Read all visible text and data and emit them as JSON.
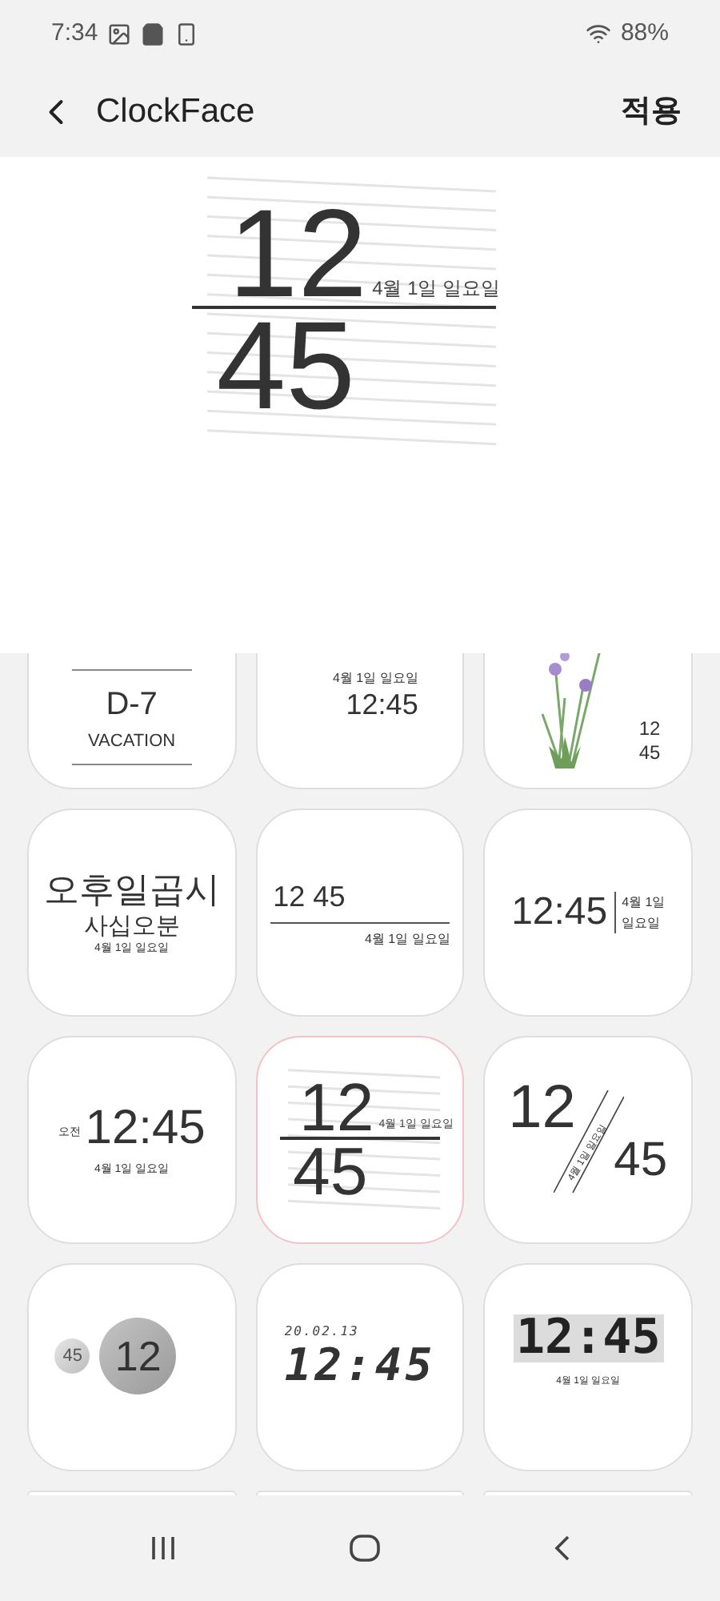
{
  "status_bar": {
    "time": "7:34",
    "battery": "88%"
  },
  "app_bar": {
    "title": "ClockFace",
    "action": "적용"
  },
  "preview": {
    "kind": "split",
    "hour": "12",
    "minute": "45",
    "date": "4월 1일 일요일"
  },
  "faces": [
    {
      "kind": "dday",
      "selected": false,
      "title": "D-7",
      "label": "VACATION"
    },
    {
      "kind": "date_time",
      "selected": false,
      "date": "4월 1일 일요일",
      "time": "12:45"
    },
    {
      "kind": "flower",
      "selected": false,
      "hour": "12",
      "minute": "45"
    },
    {
      "kind": "korean",
      "selected": false,
      "line_1": "오후일곱시",
      "line_2": "사십오분",
      "date": "4월 1일 일요일"
    },
    {
      "kind": "underline",
      "selected": false,
      "time": "12 45",
      "date": "4월 1일 일요일"
    },
    {
      "kind": "divider",
      "selected": false,
      "time": "12:45",
      "date_1": "4월 1일",
      "date_2": "일요일"
    },
    {
      "kind": "ampm",
      "selected": false,
      "ampm": "오전",
      "time": "12:45",
      "date": "4월 1일 일요일"
    },
    {
      "kind": "split",
      "selected": true,
      "hour": "12",
      "minute": "45",
      "date": "4월 1일 일요일"
    },
    {
      "kind": "diagonal",
      "selected": false,
      "hour": "12",
      "minute": "45",
      "date": "4월 1일 일요일"
    },
    {
      "kind": "bubble",
      "selected": false,
      "hour": "12",
      "minute": "45"
    },
    {
      "kind": "led",
      "selected": false,
      "date": "20.02.13",
      "time": "12:45"
    },
    {
      "kind": "block",
      "selected": false,
      "time": "12:45",
      "date": "4월 1일 일요일"
    },
    {
      "kind": "cut",
      "selected": false
    },
    {
      "kind": "cut",
      "selected": false
    },
    {
      "kind": "cut",
      "selected": false
    }
  ]
}
